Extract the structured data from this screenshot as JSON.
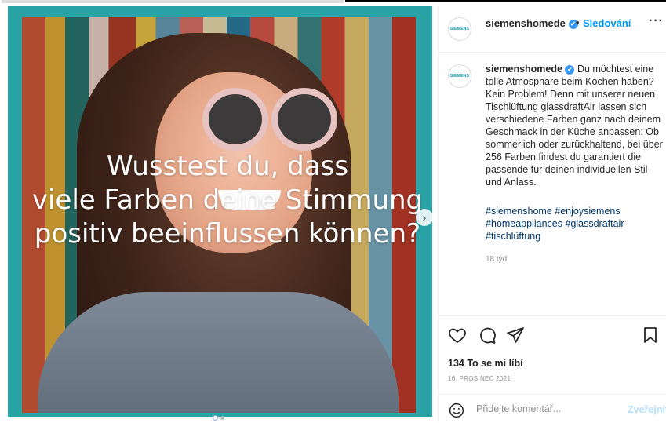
{
  "post": {
    "username": "siemenshomede",
    "verified_glyph": "✔",
    "separator": "•",
    "follow_label": "Sledování",
    "more_label": "···",
    "avatar_text": "SIEMENS",
    "media": {
      "overlay_lines": [
        "Wusstest du, dass",
        "viele Farben deine Stimmung",
        "positiv beeinflussen können?"
      ],
      "next_icon": "chevron-right-icon",
      "next_glyph": "›",
      "carousel_pages": 2,
      "carousel_active": 1
    },
    "caption": {
      "username": "siemenshomede",
      "text": "Du möchtest eine tolle Atmosphäre beim Kochen haben? Kein Problem! Denn mit unserer neuen Tischlüftung glassdraftAir lassen sich verschiedene Farben ganz nach deinem Geschmack in der Küche anpassen: Ob sommerlich oder zurückhaltend, bei über 256 Farben findest du garantiert die passende für deinen individuellen Stil und Anlass.",
      "hashtags": "#siemenshome #enjoysiemens #homeappliances #glassdraftair #tischlüftung",
      "age": "18 týd."
    },
    "actions": {
      "like_icon": "heart-icon",
      "comment_icon": "comment-icon",
      "share_icon": "send-icon",
      "save_icon": "bookmark-icon"
    },
    "likes": "134 To se mi líbí",
    "date": "16. PROSINEC 2021",
    "comment": {
      "emoji_icon": "smiley-icon",
      "placeholder": "Přidejte komentář...",
      "post_label": "Zveřejnit"
    }
  },
  "colors": {
    "link": "#00376b",
    "follow": "#0095f6",
    "post_disabled": "#b2dffc",
    "media_bg": "#2aa3a7",
    "verified": "#3897f0"
  }
}
